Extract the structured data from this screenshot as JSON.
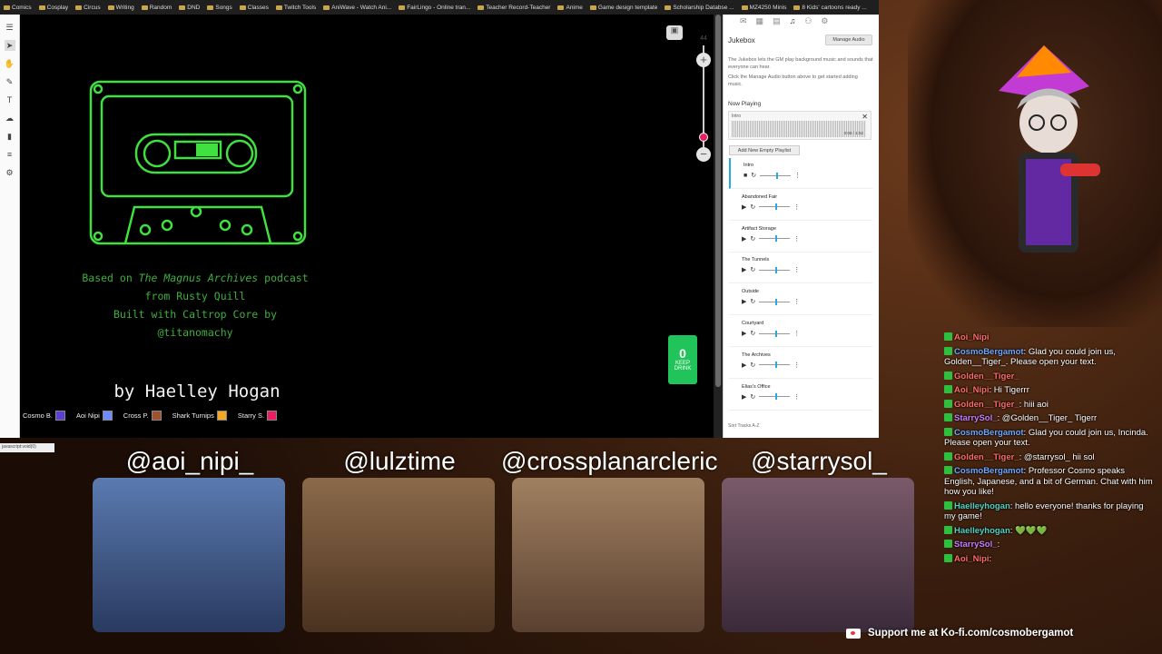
{
  "bookmarks": [
    "Comics",
    "Cosplay",
    "Circus",
    "Writing",
    "Random",
    "DND",
    "Songs",
    "Classes",
    "Twitch Tools",
    "AniWave - Watch Ani...",
    "FairLingo - Online tran...",
    "Teacher Record-Teacher",
    "Anime",
    "Game design template",
    "Scholarship Databse ...",
    "MZ4250 Minis",
    "8 Kids' cartoons ready ..."
  ],
  "game": {
    "credits": {
      "line1_pre": "Based on ",
      "line1_it": "The Magnus Archives",
      "line1_post": " podcast",
      "line2": "from Rusty Quill",
      "line3": "Built with Caltrop Core by",
      "line4": "@titanomachy"
    },
    "byline": "by Haelley Hogan",
    "zoom": "44",
    "players": [
      {
        "name": "Cosmo B.",
        "color": "#5a3fd1"
      },
      {
        "name": "Aoi Nipi",
        "color": "#6d8cff"
      },
      {
        "name": "Cross P.",
        "color": "#a0522d"
      },
      {
        "name": "Shark Turnips",
        "color": "#f5a623"
      },
      {
        "name": "Starry S.",
        "color": "#e91e63"
      }
    ],
    "kofi": {
      "value": "0",
      "label": "KEEP DRINK"
    },
    "status": "javascript:void(0)"
  },
  "jukebox": {
    "title": "Jukebox",
    "manage": "Manage Audio",
    "desc1": "The Jukebox lets the GM play background music and sounds that everyone can hear.",
    "desc2": "Click the Manage Audio button above to get started adding music.",
    "now_playing": "Now Playing",
    "np_track": "Intro",
    "np_time": "0:06 / 1:52",
    "add_playlist": "Add New Empty Playlist",
    "tracks": [
      "Intro",
      "Abandoned Fair",
      "Artifact Storage",
      "The Tunnels",
      "Outside",
      "Courtyard",
      "The Archives",
      "Elias's Office"
    ],
    "sort": "Sort Tracks A-Z"
  },
  "hosts": [
    "@aoi_nipi_",
    "@lulztime",
    "@crossplanarcleric",
    "@starrysol_"
  ],
  "chat": [
    {
      "user": "Aoi_Nipi",
      "text": "",
      "color": "#ff6b6b"
    },
    {
      "user": "CosmoBergamot",
      "text": ": Glad you could join us, Golden__Tiger_. Please open your text.",
      "color": "#6aa8ff"
    },
    {
      "user": "Golden__Tiger_",
      "text": "",
      "color": "#ff6b6b"
    },
    {
      "user": "Aoi_Nipi",
      "text": ": Hi Tigerrr",
      "color": "#ff6b6b"
    },
    {
      "user": "Golden__Tiger_",
      "text": ": hiii aoi",
      "color": "#ff6b6b"
    },
    {
      "user": "StarrySol_",
      "text": ": @Golden__Tiger_ Tigerr",
      "color": "#c77dff"
    },
    {
      "user": "CosmoBergamot",
      "text": ": Glad you could join us, Incinda. Please open your text.",
      "color": "#6aa8ff"
    },
    {
      "user": "Golden__Tiger_",
      "text": ": @starrysol_ hii sol",
      "color": "#ff6b6b"
    },
    {
      "user": "CosmoBergamot",
      "text": ": Professor Cosmo speaks English, Japanese, and a bit of German. Chat with him how you like!",
      "color": "#6aa8ff"
    },
    {
      "user": "Haelleyhogan",
      "text": ": hello everyone! thanks for playing my game!",
      "color": "#4fd1c5"
    },
    {
      "user": "Haelleyhogan",
      "text": ": 💚💚💚",
      "color": "#4fd1c5"
    },
    {
      "user": "StarrySol_",
      "text": ":",
      "color": "#c77dff"
    },
    {
      "user": "Aoi_Nipi",
      "text": ":",
      "color": "#ff6b6b"
    }
  ],
  "footer": "Support me at Ko-fi.com/cosmobergamot"
}
